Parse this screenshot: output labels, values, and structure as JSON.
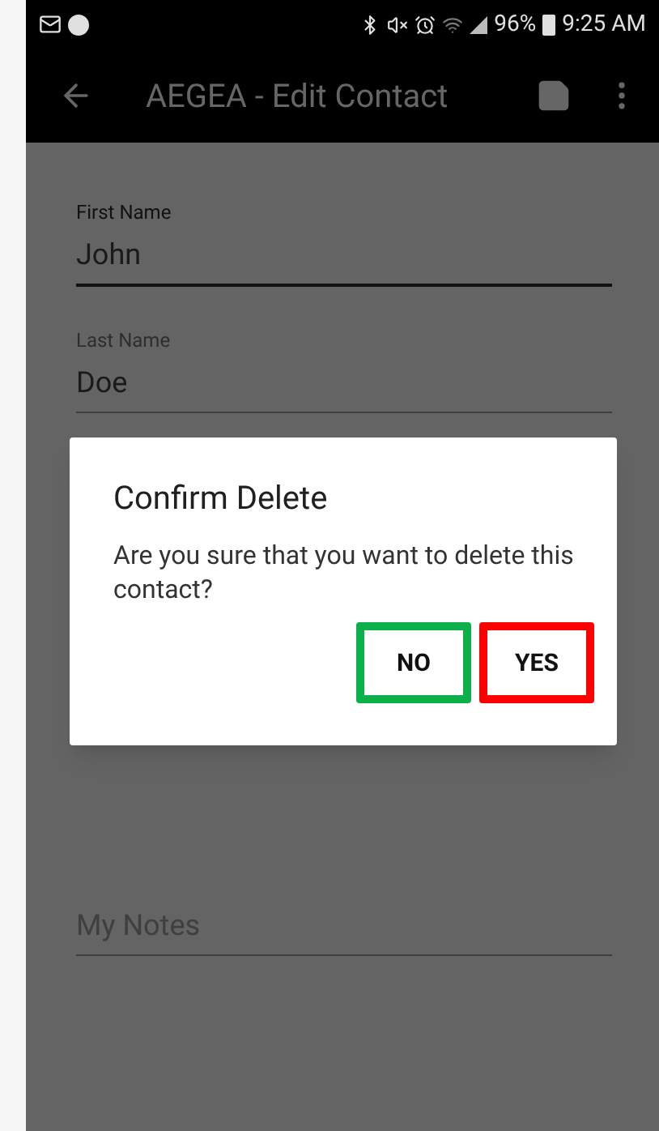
{
  "status_bar": {
    "battery": "96%",
    "time": "9:25 AM"
  },
  "app_bar": {
    "title": "AEGEA - Edit Contact"
  },
  "fields": [
    {
      "label": "First Name",
      "value": "John",
      "focused": true
    },
    {
      "label": "Last Name",
      "value": "Doe",
      "focused": false
    },
    {
      "placeholder": "My Notes",
      "focused": false
    }
  ],
  "dialog": {
    "title": "Confirm Delete",
    "message": "Are you sure that you want to delete this contact?",
    "buttons": [
      {
        "label": "NO",
        "color": "#0bb04b"
      },
      {
        "label": "YES",
        "color": "#ff0000"
      }
    ]
  }
}
